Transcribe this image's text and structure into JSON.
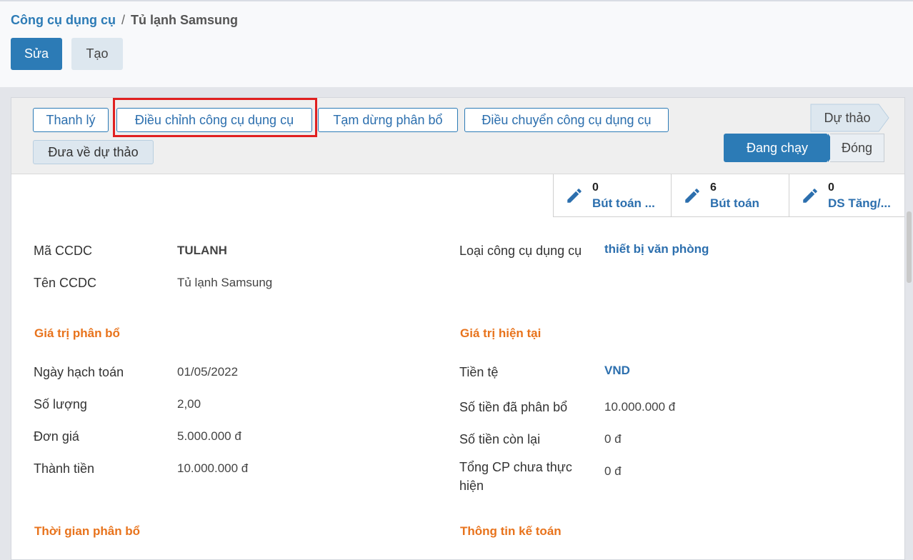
{
  "breadcrumb": {
    "parent": "Công cụ dụng cụ",
    "separator": "/",
    "current": "Tủ lạnh Samsung"
  },
  "toolbar": {
    "edit_label": "Sửa",
    "create_label": "Tạo"
  },
  "statusbar": {
    "buttons": [
      "Thanh lý",
      "Điều chỉnh công cụ dụng cụ",
      "Tạm dừng phân bổ",
      "Điều chuyển công cụ dụng cụ",
      "Đưa về dự thảo"
    ],
    "stages": {
      "draft": "Dự thảo",
      "running": "Đang chạy",
      "closed": "Đóng"
    }
  },
  "smart_buttons": [
    {
      "count": "0",
      "label": "Bút toán ..."
    },
    {
      "count": "6",
      "label": "Bút toán"
    },
    {
      "count": "0",
      "label": "DS Tăng/..."
    }
  ],
  "fields": {
    "ma_ccdc": {
      "label": "Mã CCDC",
      "value": "TULANH"
    },
    "ten_ccdc": {
      "label": "Tên CCDC",
      "value": "Tủ lạnh Samsung"
    },
    "loai": {
      "label": "Loại công cụ dụng cụ",
      "value": "thiết bị văn phòng"
    }
  },
  "sections": {
    "gia_tri_phan_bo": "Giá trị phân bổ",
    "gia_tri_hien_tai": "Giá trị hiện tại",
    "thoi_gian_phan_bo": "Thời gian phân bổ",
    "thong_tin_ke_toan": "Thông tin kế toán"
  },
  "left_values": [
    {
      "label": "Ngày hạch toán",
      "value": "01/05/2022"
    },
    {
      "label": "Số lượng",
      "value": "2,00"
    },
    {
      "label": "Đơn giá",
      "value": "5.000.000 đ"
    },
    {
      "label": "Thành tiền",
      "value": "10.000.000 đ"
    }
  ],
  "right_values": [
    {
      "label": "Tiền tệ",
      "value": "VND"
    },
    {
      "label": "Số tiền đã phân bổ",
      "value": "10.000.000 đ"
    },
    {
      "label": "Số tiền còn lại",
      "value": "0 đ"
    },
    {
      "label_line1": "Tổng CP chưa thực",
      "label_line2": "hiện",
      "value": "0 đ"
    }
  ],
  "colors": {
    "primary": "#2c7bb6",
    "section": "#e8731c",
    "highlight": "#e02020"
  }
}
